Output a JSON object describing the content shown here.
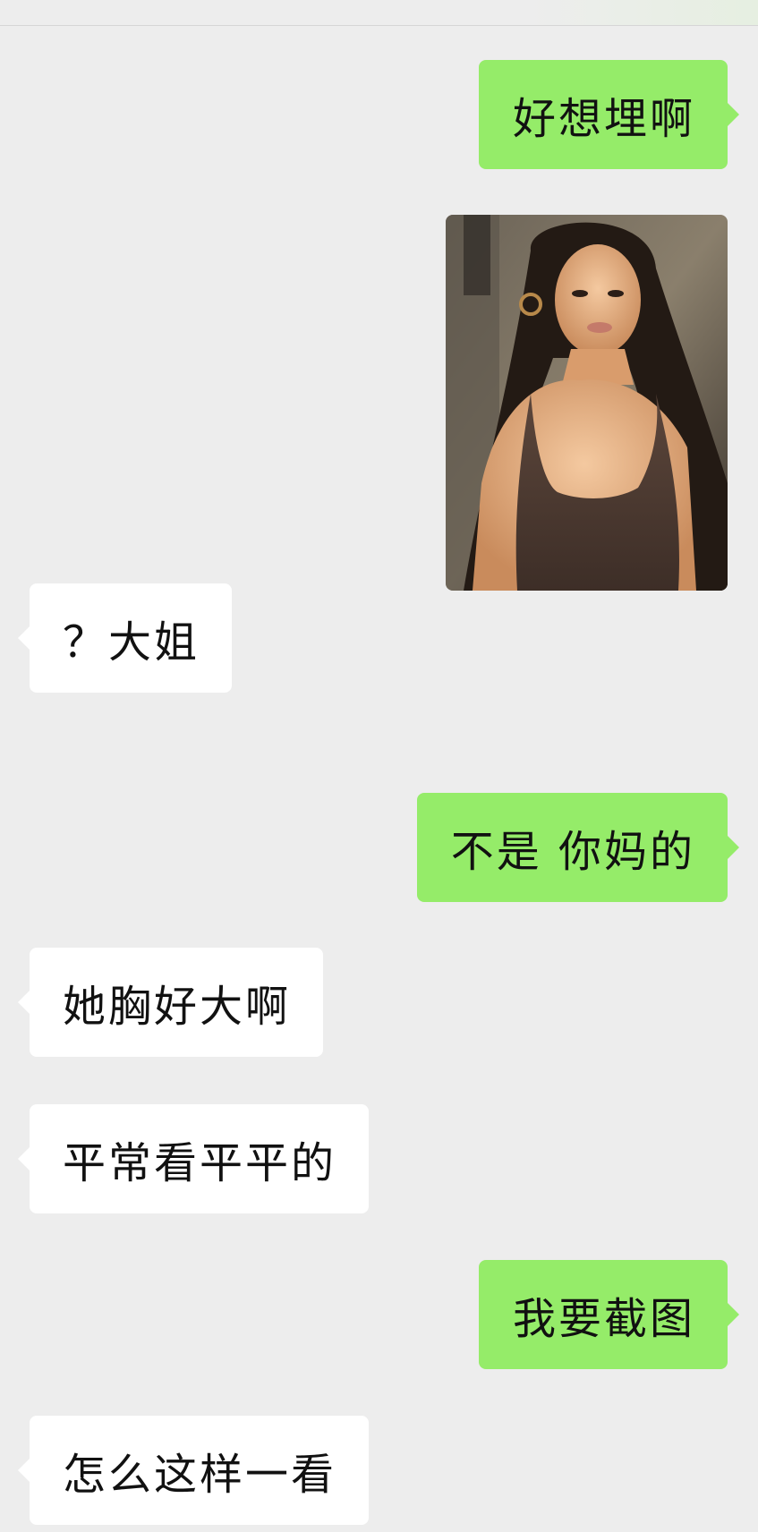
{
  "colors": {
    "background": "#ededed",
    "outgoing_bubble": "#95ec69",
    "incoming_bubble": "#ffffff",
    "text": "#111111"
  },
  "messages": [
    {
      "direction": "outgoing",
      "type": "text",
      "text": "好想埋啊"
    },
    {
      "direction": "outgoing",
      "type": "image",
      "image": "selfie-photo"
    },
    {
      "direction": "incoming",
      "type": "text",
      "text": "？大姐"
    },
    {
      "direction": "outgoing",
      "type": "text",
      "text": "不是 你妈的"
    },
    {
      "direction": "incoming",
      "type": "text",
      "text": "她胸好大啊"
    },
    {
      "direction": "incoming",
      "type": "text",
      "text": "平常看平平的"
    },
    {
      "direction": "outgoing",
      "type": "text",
      "text": "我要截图"
    },
    {
      "direction": "incoming",
      "type": "text",
      "text": "怎么这样一看"
    }
  ]
}
